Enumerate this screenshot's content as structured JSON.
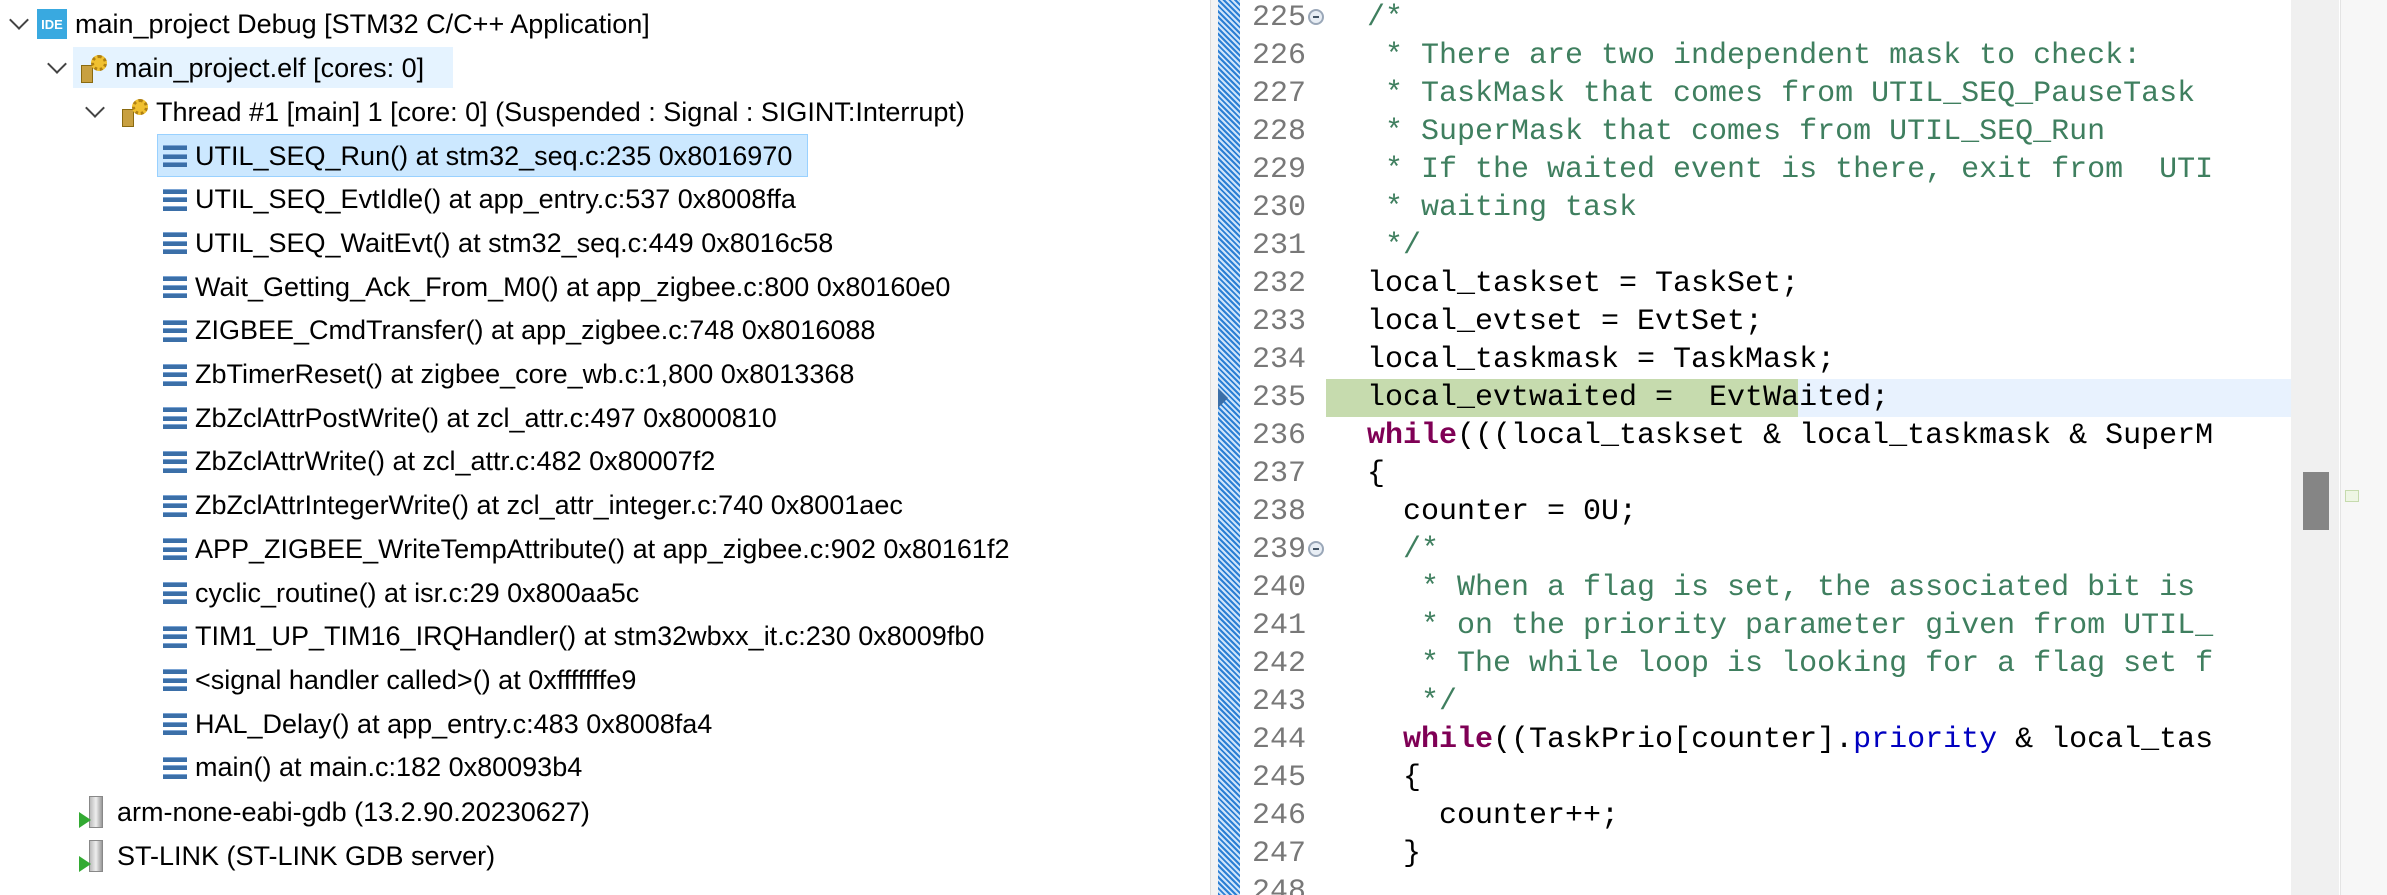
{
  "debug_tree": {
    "launch": "main_project Debug [STM32 C/C++ Application]",
    "launch_icon_text": "IDE",
    "process": "main_project.elf [cores: 0]",
    "thread": "Thread #1 [main] 1 [core: 0] (Suspended : Signal : SIGINT:Interrupt)",
    "frames": [
      "UTIL_SEQ_Run() at stm32_seq.c:235 0x8016970",
      "UTIL_SEQ_EvtIdle() at app_entry.c:537 0x8008ffa",
      "UTIL_SEQ_WaitEvt() at stm32_seq.c:449 0x8016c58",
      "Wait_Getting_Ack_From_M0() at app_zigbee.c:800 0x80160e0",
      "ZIGBEE_CmdTransfer() at app_zigbee.c:748 0x8016088",
      "ZbTimerReset() at zigbee_core_wb.c:1,800 0x8013368",
      "ZbZclAttrPostWrite() at zcl_attr.c:497 0x8000810",
      "ZbZclAttrWrite() at zcl_attr.c:482 0x80007f2",
      "ZbZclAttrIntegerWrite() at zcl_attr_integer.c:740 0x8001aec",
      "APP_ZIGBEE_WriteTempAttribute() at app_zigbee.c:902 0x80161f2",
      "cyclic_routine() at isr.c:29 0x800aa5c",
      "TIM1_UP_TIM16_IRQHandler() at stm32wbxx_it.c:230 0x8009fb0",
      "<signal handler called>() at 0xfffffffe9",
      "HAL_Delay() at app_entry.c:483 0x8008fa4",
      "main() at main.c:182 0x80093b4"
    ],
    "selected_frame": 0,
    "gdb": "arm-none-eabi-gdb (13.2.90.20230627)",
    "server": "ST-LINK (ST-LINK GDB server)"
  },
  "editor": {
    "current_line": 235,
    "colors": {
      "comment": "#3f7f5f",
      "keyword": "#7f0055",
      "field": "#0000c0",
      "pc_highlight": "#c6dbae"
    },
    "lines": [
      {
        "num": "225",
        "fold": true,
        "tokens": [
          {
            "t": "/*",
            "c": "c"
          }
        ]
      },
      {
        "num": "226",
        "tokens": [
          {
            "t": " * There are two independent mask to check:",
            "c": "c"
          }
        ]
      },
      {
        "num": "227",
        "tokens": [
          {
            "t": " * TaskMask that comes from UTIL_SEQ_PauseTask",
            "c": "c"
          }
        ]
      },
      {
        "num": "228",
        "tokens": [
          {
            "t": " * SuperMask that comes from UTIL_SEQ_Run",
            "c": "c"
          }
        ]
      },
      {
        "num": "229",
        "tokens": [
          {
            "t": " * If the waited event is there, exit from  UTI",
            "c": "c"
          }
        ]
      },
      {
        "num": "230",
        "tokens": [
          {
            "t": " * waiting task",
            "c": "c"
          }
        ]
      },
      {
        "num": "231",
        "tokens": [
          {
            "t": " */",
            "c": "c"
          }
        ]
      },
      {
        "num": "232",
        "tokens": [
          {
            "t": "local_taskset = TaskSet;",
            "c": "p"
          }
        ]
      },
      {
        "num": "233",
        "tokens": [
          {
            "t": "local_evtset = EvtSet;",
            "c": "p"
          }
        ]
      },
      {
        "num": "234",
        "tokens": [
          {
            "t": "local_taskmask = TaskMask;",
            "c": "p"
          }
        ]
      },
      {
        "num": "235",
        "tokens": [
          {
            "t": "local_evtwaited =  EvtWaited;",
            "c": "p"
          }
        ]
      },
      {
        "num": "236",
        "tokens": [
          {
            "t": "while",
            "c": "k"
          },
          {
            "t": "(((local_taskset & local_taskmask & SuperM",
            "c": "p"
          }
        ]
      },
      {
        "num": "237",
        "tokens": [
          {
            "t": "{",
            "c": "p"
          }
        ]
      },
      {
        "num": "238",
        "tokens": [
          {
            "t": "  counter = 0U;",
            "c": "p"
          }
        ]
      },
      {
        "num": "239",
        "fold": true,
        "tokens": [
          {
            "t": "  /*",
            "c": "c"
          }
        ]
      },
      {
        "num": "240",
        "tokens": [
          {
            "t": "   * When a flag is set, the associated bit is",
            "c": "c"
          }
        ]
      },
      {
        "num": "241",
        "tokens": [
          {
            "t": "   * on the priority parameter given from UTIL_",
            "c": "c"
          }
        ]
      },
      {
        "num": "242",
        "tokens": [
          {
            "t": "   * The while loop is looking for a flag set f",
            "c": "c"
          }
        ]
      },
      {
        "num": "243",
        "tokens": [
          {
            "t": "   */",
            "c": "c"
          }
        ]
      },
      {
        "num": "244",
        "tokens": [
          {
            "t": "  ",
            "c": "p"
          },
          {
            "t": "while",
            "c": "k"
          },
          {
            "t": "((TaskPrio[counter].",
            "c": "p"
          },
          {
            "t": "priority",
            "c": "f"
          },
          {
            "t": " & local_tas",
            "c": "p"
          }
        ]
      },
      {
        "num": "245",
        "tokens": [
          {
            "t": "  {",
            "c": "p"
          }
        ]
      },
      {
        "num": "246",
        "tokens": [
          {
            "t": "    counter++;",
            "c": "p"
          }
        ]
      },
      {
        "num": "247",
        "tokens": [
          {
            "t": "  }",
            "c": "p"
          }
        ]
      },
      {
        "num": "248",
        "tokens": []
      }
    ]
  }
}
